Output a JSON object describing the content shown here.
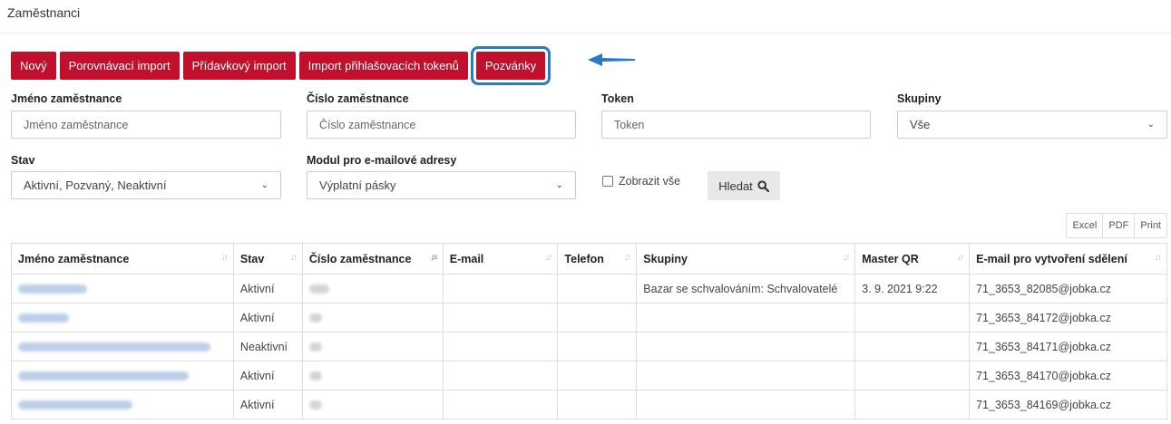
{
  "page": {
    "title": "Zaměstnanci"
  },
  "toolbar": {
    "buttons": [
      "Nový",
      "Porovnávací import",
      "Přídavkový import",
      "Import přihlašovacích tokenů",
      "Pozvánky"
    ],
    "accent_color": "#c0102c",
    "highlight_color": "#2a7bc7"
  },
  "filters": {
    "employee_name": {
      "label": "Jméno zaměstnance",
      "placeholder": "Jméno zaměstnance"
    },
    "employee_number": {
      "label": "Číslo zaměstnance",
      "placeholder": "Číslo zaměstnance"
    },
    "token": {
      "label": "Token",
      "placeholder": "Token"
    },
    "groups": {
      "label": "Skupiny",
      "value": "Vše"
    },
    "status": {
      "label": "Stav",
      "value": "Aktivní, Pozvaný, Neaktivní"
    },
    "email_module": {
      "label": "Modul pro e-mailové adresy",
      "value": "Výplatní pásky"
    },
    "show_all": {
      "label": "Zobrazit vše",
      "checked": false
    },
    "search_button": "Hledat",
    "search_icon": "search-icon"
  },
  "export": {
    "excel": "Excel",
    "pdf": "PDF",
    "print": "Print"
  },
  "table": {
    "columns": [
      "Jméno zaměstnance",
      "Stav",
      "Číslo zaměstnance",
      "E-mail",
      "Telefon",
      "Skupiny",
      "Master QR",
      "E-mail pro vytvoření sdělení"
    ],
    "rows": [
      {
        "stav": "Aktivní",
        "skupiny": "Bazar se schvalováním: Schvalovatelé",
        "master_qr": "3. 9. 2021 9:22",
        "email_msg": "71_3653_82085@jobka.cz"
      },
      {
        "stav": "Aktivní",
        "skupiny": "",
        "master_qr": "",
        "email_msg": "71_3653_84172@jobka.cz"
      },
      {
        "stav": "Neaktivní",
        "skupiny": "",
        "master_qr": "",
        "email_msg": "71_3653_84171@jobka.cz"
      },
      {
        "stav": "Aktivní",
        "skupiny": "",
        "master_qr": "",
        "email_msg": "71_3653_84170@jobka.cz"
      },
      {
        "stav": "Aktivní",
        "skupiny": "",
        "master_qr": "",
        "email_msg": "71_3653_84169@jobka.cz"
      }
    ]
  }
}
